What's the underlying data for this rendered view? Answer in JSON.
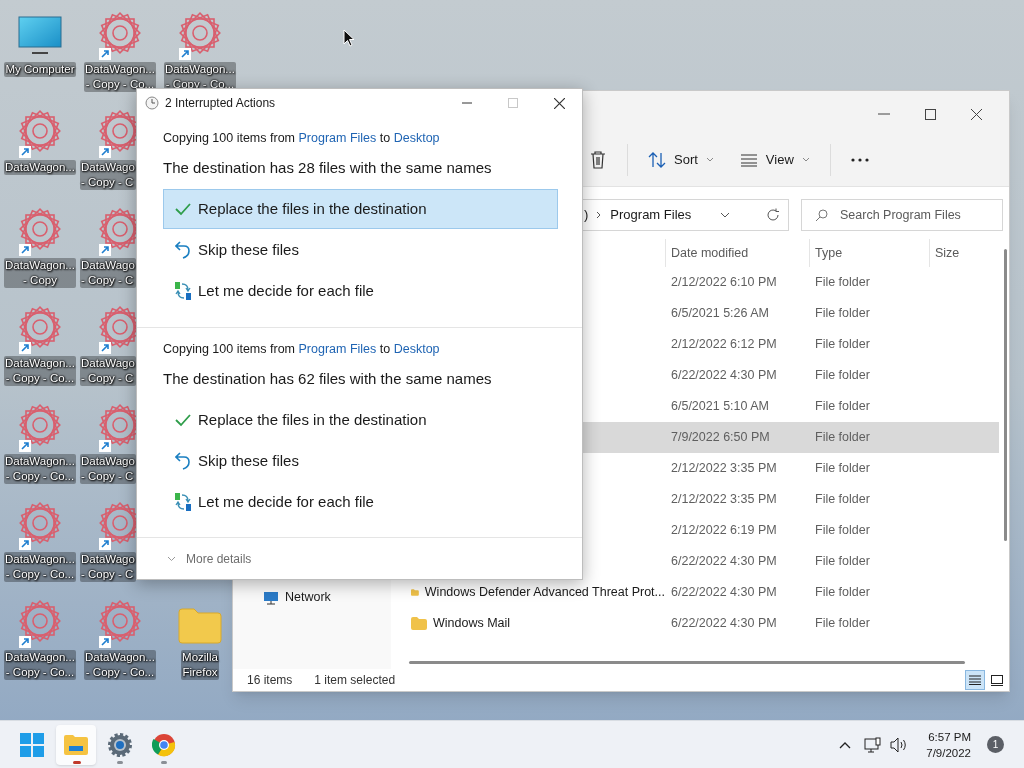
{
  "desktop": {
    "columns": [
      [
        {
          "kind": "computer",
          "label": [
            "My Computer"
          ],
          "cut_off": false
        },
        {
          "kind": "shortcut",
          "label": [
            "DataWagon..."
          ],
          "cut_off": false
        },
        {
          "kind": "shortcut",
          "label": [
            "DataWagon...",
            "- Copy"
          ],
          "cut_off": false
        },
        {
          "kind": "shortcut",
          "label": [
            "DataWagon...",
            "- Copy - Co..."
          ],
          "cut_off": false
        },
        {
          "kind": "shortcut",
          "label": [
            "DataWagon...",
            "- Copy - Co..."
          ],
          "cut_off": false
        },
        {
          "kind": "shortcut",
          "label": [
            "DataWagon...",
            "- Copy - Co..."
          ],
          "cut_off": false
        },
        {
          "kind": "shortcut",
          "label": [
            "DataWagon...",
            "- Copy - Co..."
          ],
          "cut_off": false
        }
      ],
      [
        {
          "kind": "shortcut",
          "label": [
            "DataWagon...",
            "- Copy - Co..."
          ],
          "cut_off": false
        },
        {
          "kind": "shortcut",
          "label": [
            "DataWago",
            "- Copy - C"
          ],
          "cut_off": true
        },
        {
          "kind": "shortcut",
          "label": [
            "DataWago",
            "- Copy - C"
          ],
          "cut_off": true
        },
        {
          "kind": "shortcut",
          "label": [
            "DataWago",
            "- Copy - C"
          ],
          "cut_off": true
        },
        {
          "kind": "shortcut",
          "label": [
            "DataWago",
            "- Copy - C"
          ],
          "cut_off": true
        },
        {
          "kind": "shortcut",
          "label": [
            "DataWago",
            "- Copy - C"
          ],
          "cut_off": true
        },
        {
          "kind": "shortcut",
          "label": [
            "DataWagon...",
            "- Copy - Co..."
          ],
          "cut_off": false
        }
      ],
      [
        {
          "kind": "shortcut",
          "label": [
            "DataWagon...",
            "- Copy - Co..."
          ],
          "cut_off": false
        },
        {
          "kind": "folder",
          "label": [
            "Mozilla",
            "Firefox"
          ],
          "cut_off": false
        }
      ]
    ]
  },
  "explorer": {
    "toolbar": [
      {
        "kind": "delete"
      },
      {
        "kind": "sort",
        "label": "Sort"
      },
      {
        "kind": "view",
        "label": "View"
      },
      {
        "kind": "more"
      }
    ],
    "address": [
      ")",
      "Program Files"
    ],
    "search": {
      "placeholder": "Search Program Files"
    },
    "nav": [
      {
        "label": "Network"
      }
    ],
    "columns": [
      "Date modified",
      "Type",
      "Size"
    ],
    "rows": [
      {
        "date": "2/12/2022 6:10 PM",
        "type": "File folder",
        "selected": false
      },
      {
        "date": "6/5/2021 5:26 AM",
        "type": "File folder",
        "selected": false
      },
      {
        "date": "2/12/2022 6:12 PM",
        "type": "File folder",
        "selected": false
      },
      {
        "date": "6/22/2022 4:30 PM",
        "type": "File folder",
        "selected": false
      },
      {
        "date": "6/5/2021 5:10 AM",
        "type": "File folder",
        "selected": false
      },
      {
        "date": "7/9/2022 6:50 PM",
        "type": "File folder",
        "selected": true
      },
      {
        "date": "2/12/2022 3:35 PM",
        "type": "File folder",
        "selected": false
      },
      {
        "date": "2/12/2022 3:35 PM",
        "type": "File folder",
        "selected": false
      },
      {
        "date": "2/12/2022 6:19 PM",
        "type": "File folder",
        "selected": false
      },
      {
        "date": "6/22/2022 4:30 PM",
        "type": "File folder",
        "selected": false
      },
      {
        "name": "Windows Defender Advanced Threat Prot...",
        "date": "6/22/2022 4:30 PM",
        "type": "File folder",
        "selected": false
      },
      {
        "name": "Windows Mail",
        "date": "6/22/2022 4:30 PM",
        "type": "File folder",
        "selected": false
      }
    ],
    "status": {
      "count": "16 items",
      "selection": "1 item selected"
    },
    "views": [
      {
        "kind": "details",
        "selected": true
      },
      {
        "kind": "tiles",
        "selected": false
      }
    ]
  },
  "dialog": {
    "title": "2 Interrupted Actions",
    "operations": [
      {
        "prefix": "Copying 100 items from",
        "source": "Program Files",
        "middle": "to",
        "destination": "Desktop",
        "heading": "The destination has 28 files with the same names",
        "options": [
          {
            "kind": "replace",
            "label": "Replace the files in the destination",
            "selected": true
          },
          {
            "kind": "skip",
            "label": "Skip these files",
            "selected": false
          },
          {
            "kind": "decide",
            "label": "Let me decide for each file",
            "selected": false
          }
        ]
      },
      {
        "prefix": "Copying 100 items from",
        "source": "Program Files",
        "middle": "to",
        "destination": "Desktop",
        "heading": "The destination has 62 files with the same names",
        "options": [
          {
            "kind": "replace",
            "label": "Replace the files in the destination",
            "selected": false
          },
          {
            "kind": "skip",
            "label": "Skip these files",
            "selected": false
          },
          {
            "kind": "decide",
            "label": "Let me decide for each file",
            "selected": false
          }
        ]
      }
    ],
    "more_details": "More details"
  },
  "taskbar": {
    "apps": [
      {
        "kind": "start",
        "active": false,
        "running": false
      },
      {
        "kind": "explorer",
        "active": true,
        "running": true
      },
      {
        "kind": "settings",
        "active": false,
        "running": true
      },
      {
        "kind": "browser",
        "active": false,
        "running": true
      }
    ],
    "clock": {
      "time": "6:57 PM",
      "date": "7/9/2022"
    },
    "notifications": "1"
  }
}
